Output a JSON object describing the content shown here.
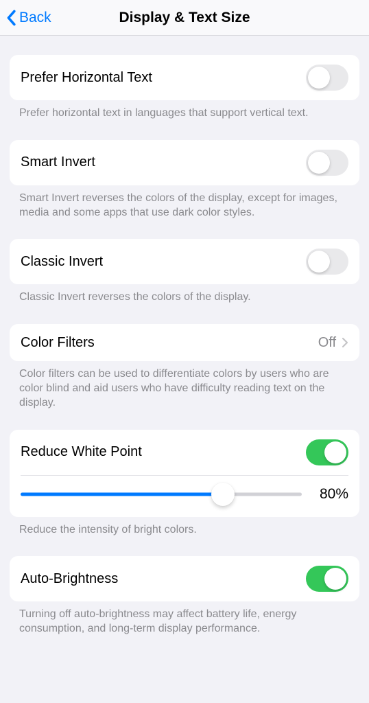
{
  "nav": {
    "back": "Back",
    "title": "Display & Text Size"
  },
  "prefer_horizontal": {
    "label": "Prefer Horizontal Text",
    "on": false,
    "footer": "Prefer horizontal text in languages that support vertical text."
  },
  "smart_invert": {
    "label": "Smart Invert",
    "on": false,
    "footer": "Smart Invert reverses the colors of the display, except for images, media and some apps that use dark color styles."
  },
  "classic_invert": {
    "label": "Classic Invert",
    "on": false,
    "footer": "Classic Invert reverses the colors of the display."
  },
  "color_filters": {
    "label": "Color Filters",
    "value": "Off",
    "footer": "Color filters can be used to differentiate colors by users who are color blind and aid users who have difficulty reading text on the display."
  },
  "reduce_white_point": {
    "label": "Reduce White Point",
    "on": true,
    "percent_value": 80,
    "percent_label": "80%",
    "slider_fill_pct": 72,
    "footer": "Reduce the intensity of bright colors."
  },
  "auto_brightness": {
    "label": "Auto-Brightness",
    "on": true,
    "footer": "Turning off auto-brightness may affect battery life, energy consumption, and long-term display performance."
  }
}
